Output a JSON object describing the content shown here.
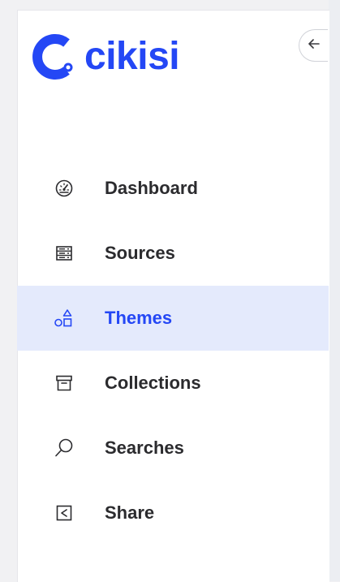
{
  "brand": {
    "name": "cikisi",
    "color": "#2447f5"
  },
  "sidebar": {
    "collapse_icon": "arrow-left-icon",
    "items": [
      {
        "label": "Dashboard",
        "icon": "gauge-icon",
        "active": false
      },
      {
        "label": "Sources",
        "icon": "server-icon",
        "active": false
      },
      {
        "label": "Themes",
        "icon": "shapes-icon",
        "active": true
      },
      {
        "label": "Collections",
        "icon": "archive-icon",
        "active": false
      },
      {
        "label": "Searches",
        "icon": "search-icon",
        "active": false
      },
      {
        "label": "Share",
        "icon": "share-icon",
        "active": false
      }
    ]
  },
  "colors": {
    "active_bg": "#e4eafc",
    "active_text": "#2447f5",
    "text": "#2b2b2e"
  }
}
